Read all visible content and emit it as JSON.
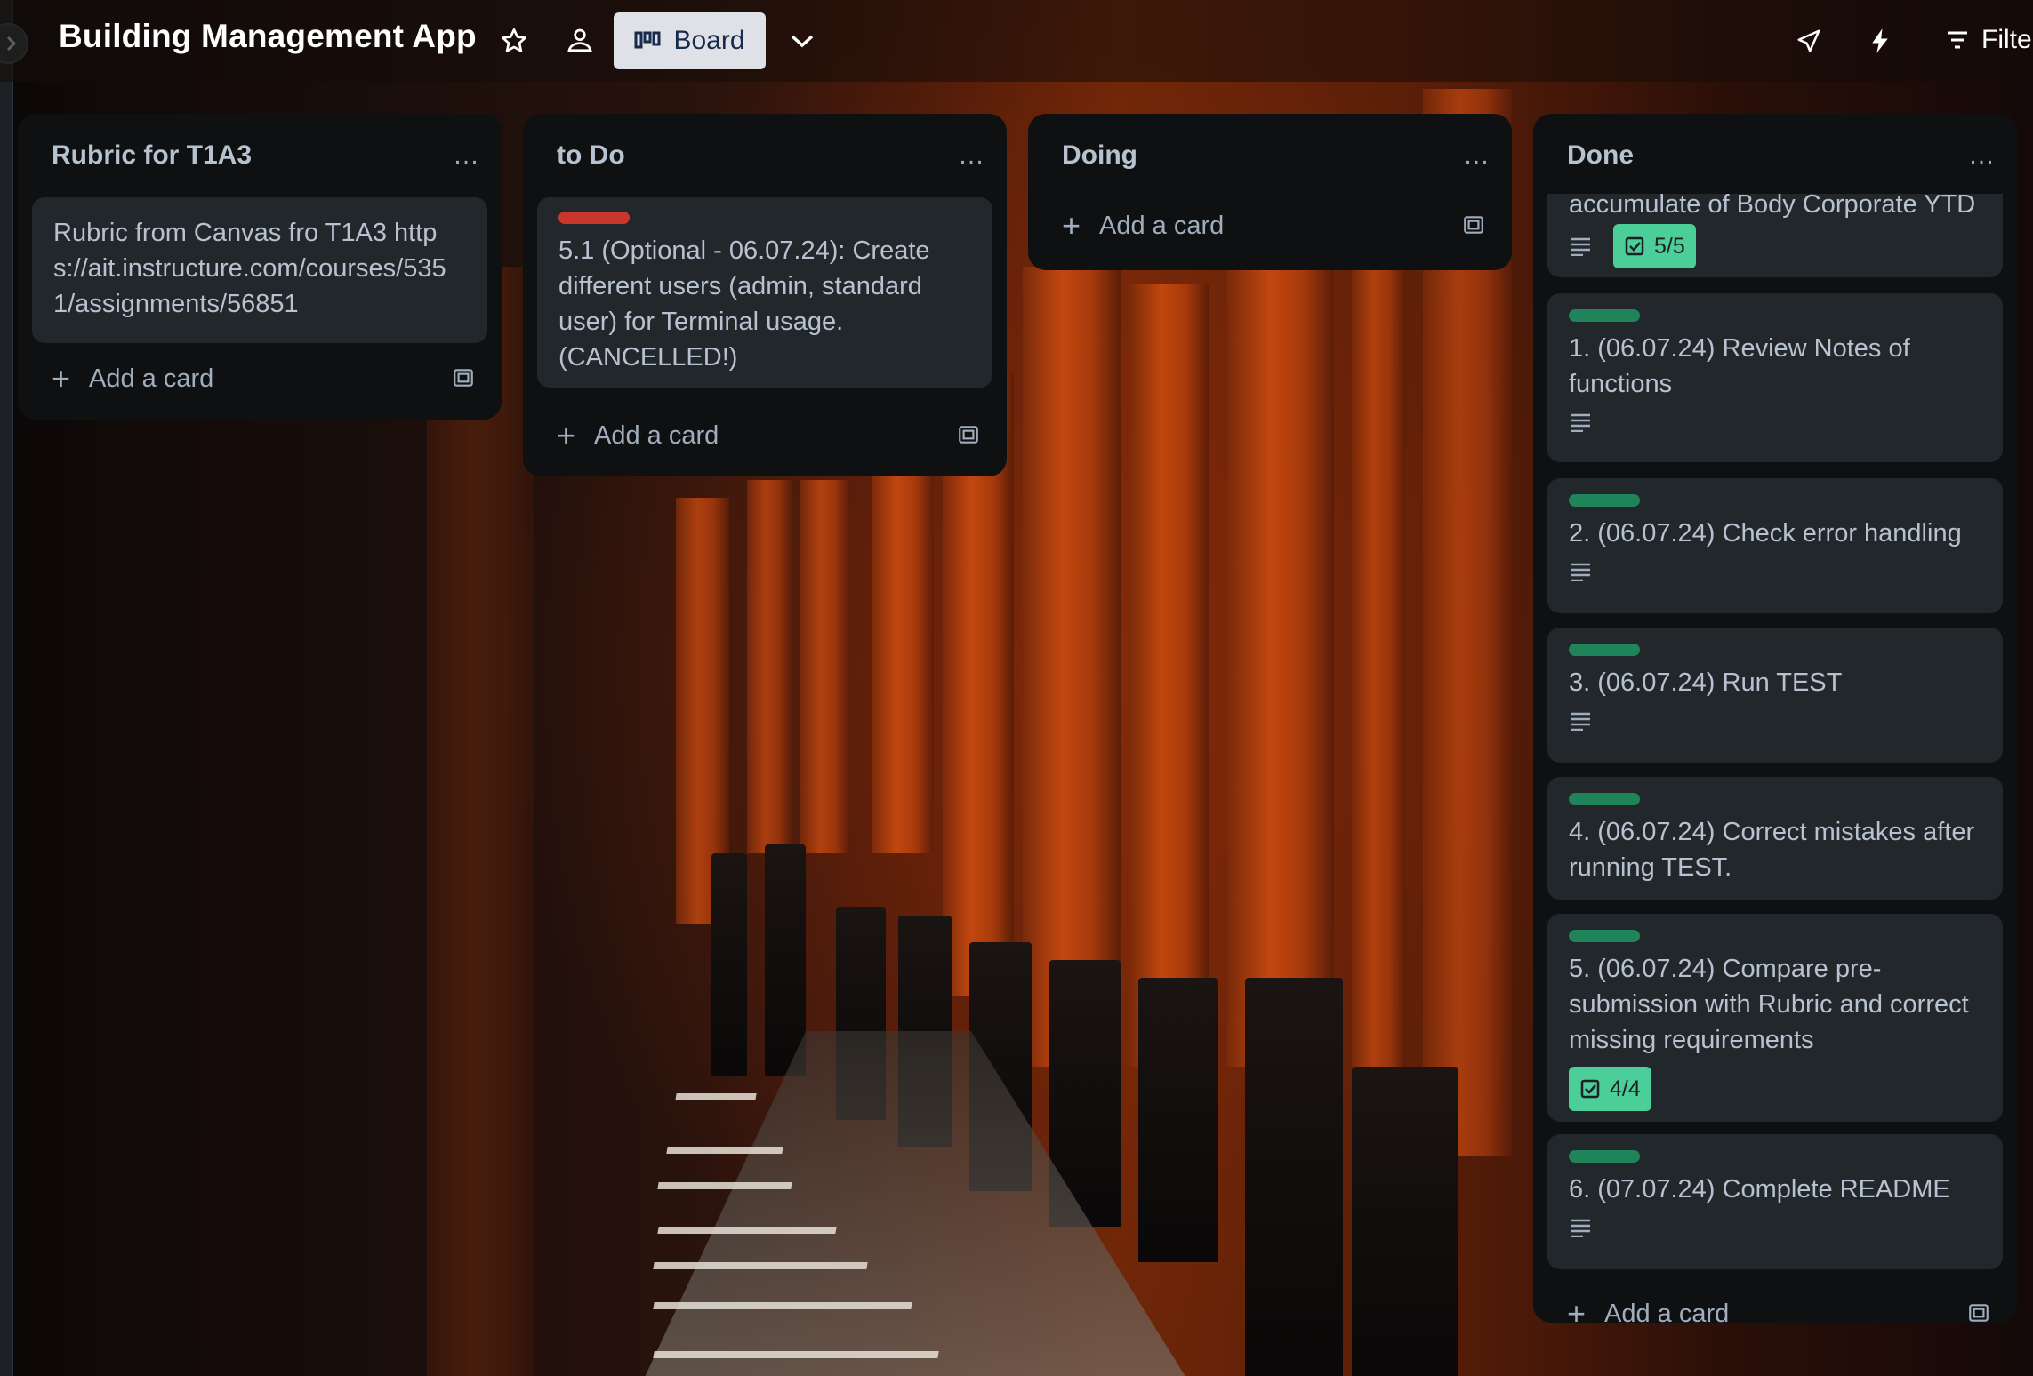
{
  "header": {
    "board_title": "Building Management App",
    "view_button": "Board",
    "filter_label": "Filte"
  },
  "icons": {
    "star": "star-icon",
    "workspace": "people-icon",
    "board_view": "board-icon",
    "view_switcher": "chevron-down-icon",
    "power_ups": "rocket-icon",
    "automation": "lightning-icon",
    "filter": "filter-icon",
    "add": "plus-icon",
    "template": "template-icon",
    "description": "description-icon",
    "checklist": "checklist-icon"
  },
  "lists": [
    {
      "title": "Rubric for T1A3",
      "menu": "…",
      "cards": [
        {
          "text": "Rubric from Canvas fro T1A3 https://ait.instructure.com/courses/5351/assignments/56851"
        }
      ],
      "add_card": "Add a card"
    },
    {
      "title": "to Do",
      "menu": "…",
      "cards": [
        {
          "label": "red",
          "text": "5.1 (Optional - 06.07.24): Create different users (admin, standard user) for Terminal usage. (CANCELLED!)"
        }
      ],
      "add_card": "Add a card"
    },
    {
      "title": "Doing",
      "menu": "…",
      "cards": [],
      "add_card": "Add a card"
    },
    {
      "title": "Done",
      "menu": "…",
      "cards": [
        {
          "text": "accumulate of Body Corporate YTD",
          "checklist": "5/5",
          "has_description": true
        },
        {
          "label": "green",
          "text": "1. (06.07.24) Review Notes of functions",
          "has_description": true
        },
        {
          "label": "green",
          "text": "2. (06.07.24) Check error handling",
          "has_description": true
        },
        {
          "label": "green",
          "text": "3. (06.07.24) Run TEST",
          "has_description": true
        },
        {
          "label": "green",
          "text": "4. (06.07.24) Correct mistakes after running TEST."
        },
        {
          "label": "green",
          "text": "5. (06.07.24) Compare pre-submission with Rubric and correct missing requirements",
          "checklist": "4/4"
        },
        {
          "label": "green",
          "text": "6. (07.07.24) Complete README",
          "has_description": true
        }
      ],
      "add_card": "Add a card"
    }
  ],
  "colors": {
    "label_red": "#c9372c",
    "label_green": "#1f845a",
    "checklist_complete": "#4bce97",
    "list_bg": "#0f1012",
    "card_bg": "#22272b"
  }
}
